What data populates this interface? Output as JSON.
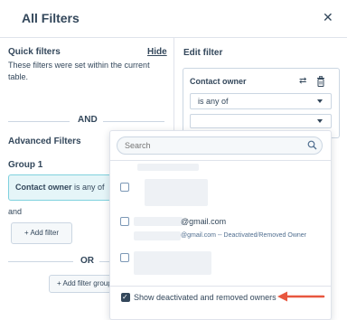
{
  "header": {
    "title": "All Filters",
    "close_glyph": "✕"
  },
  "quick_filters": {
    "title": "Quick filters",
    "hide_label": "Hide",
    "description": "These filters were set within the current table."
  },
  "separator_and": "AND",
  "advanced": {
    "title": "Advanced Filters",
    "group_title": "Group 1",
    "filter_property": "Contact owner",
    "filter_operator": "is any of",
    "and_label": "and",
    "add_filter_label": "+ Add filter",
    "separator_or": "OR",
    "add_group_label": "+ Add filter group"
  },
  "edit_filter": {
    "title": "Edit filter",
    "property": "Contact owner",
    "operator_value": "is any of",
    "swap_glyph": "⇄"
  },
  "dropdown": {
    "search_placeholder": "Search",
    "option_email": "@gmail.com",
    "option_email_sub": "@gmail.com -- Deactivated/Removed Owner",
    "show_deactivated_label": "Show deactivated and removed owners",
    "show_deactivated_checked": true,
    "checkmark_glyph": "✓"
  },
  "colors": {
    "text": "#33475b",
    "annotation_arrow": "#e8573f",
    "selected_card_bg": "#e5f5f8",
    "selected_card_border": "#7fd1de"
  }
}
